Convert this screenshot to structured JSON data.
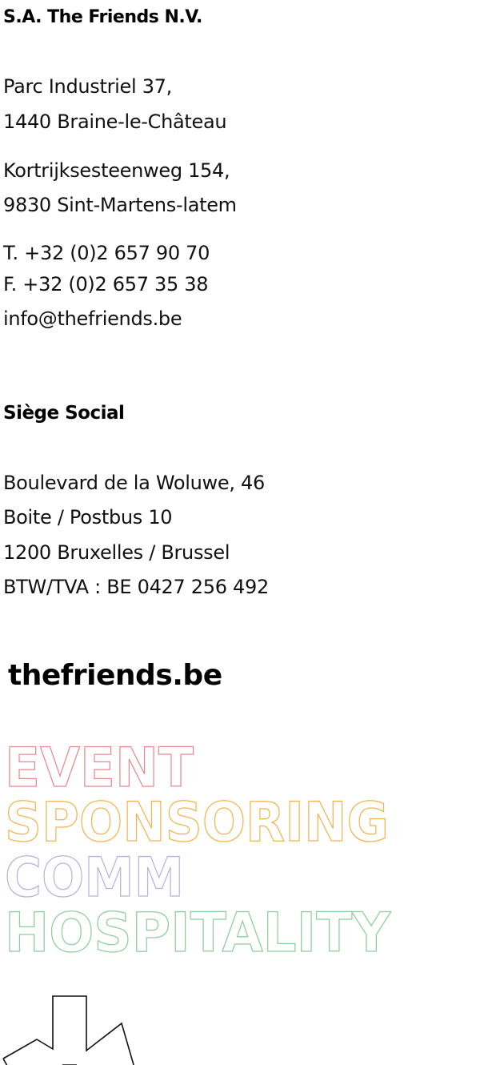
{
  "company": {
    "name": "S.A. The Friends N.V."
  },
  "addresses": {
    "braine": {
      "line1": "Parc Industriel 37,",
      "line2": "1440 Braine-le-Château"
    },
    "sint_martens": {
      "line1": "Kortrijksesteenweg 154,",
      "line2": "9830 Sint-Martens-latem"
    }
  },
  "contact": {
    "phone": "T. +32 (0)2 657 90 70",
    "fax": "F. +32 (0)2 657 35 38",
    "email": "info@thefriends.be"
  },
  "siege_social": {
    "title": "Siège Social",
    "line1": "Boulevard de la Woluwe, 46",
    "line2": "Boite / Postbus 10",
    "line3": "1200 Bruxelles / Brussel",
    "vat": "BTW/TVA : BE 0427 256 492"
  },
  "brand": {
    "label": "thefriends.be"
  },
  "services": [
    {
      "label": "EVENT",
      "color": "#e58a90"
    },
    {
      "label": "SPONSORING",
      "color": "#f2b44f"
    },
    {
      "label": "COMM",
      "color": "#b3b3de"
    },
    {
      "label": "HOSPITALITY",
      "color": "#8fcf9d"
    }
  ],
  "icons": {
    "star": "asterisk-star-icon"
  }
}
